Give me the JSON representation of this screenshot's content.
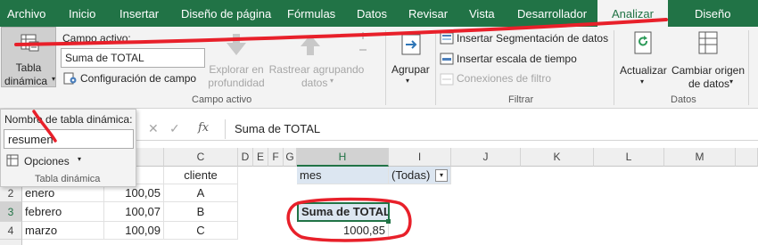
{
  "ribbon_tabs": [
    "Archivo",
    "Inicio",
    "Insertar",
    "Diseño de página",
    "Fórmulas",
    "Datos",
    "Revisar",
    "Vista",
    "Desarrollador",
    "Analizar",
    "Diseño"
  ],
  "active_tab": "Analizar",
  "pivot_button": {
    "line1": "Tabla",
    "line2": "dinámica"
  },
  "campo_activo": {
    "label": "Campo activo:",
    "value": "Suma de TOTAL",
    "config": "Configuración de campo",
    "explorar": [
      "Explorar en",
      "profundidad"
    ],
    "rastrear": [
      "Rastrear agrupando",
      "datos"
    ],
    "group_label": "Campo activo"
  },
  "agrupar": "Agrupar",
  "filtrar": {
    "segmentacion": "Insertar Segmentación de datos",
    "escala": "Insertar escala de tiempo",
    "conexiones": "Conexiones de filtro",
    "group_label": "Filtrar"
  },
  "datos": {
    "actualizar": "Actualizar",
    "cambiar": [
      "Cambiar origen",
      "de datos"
    ],
    "group_label": "Datos"
  },
  "popup": {
    "name_label": "Nombre de tabla dinámica:",
    "name_value": "resumen",
    "options": "Opciones",
    "group_label": "Tabla dinámica"
  },
  "formula": {
    "fx": "fx",
    "content": "Suma de TOTAL"
  },
  "columns": [
    "C",
    "D",
    "E",
    "F",
    "G",
    "H",
    "I",
    "J",
    "K",
    "L",
    "M"
  ],
  "rows": [
    {
      "num": "",
      "b": "",
      "c": "cliente",
      "h": "mes",
      "i": "(Todas)"
    },
    {
      "num": "2",
      "a": "enero",
      "b": "100,05",
      "c": "A"
    },
    {
      "num": "3",
      "a": "febrero",
      "b": "100,07",
      "c": "B",
      "h": "Suma de TOTAL"
    },
    {
      "num": "4",
      "a": "marzo",
      "b": "100,09",
      "c": "C",
      "h": "1000,85"
    }
  ],
  "colors": {
    "excel_green": "#217346",
    "annotation_red": "#e8202a",
    "pivot_header": "#dce6f1"
  }
}
